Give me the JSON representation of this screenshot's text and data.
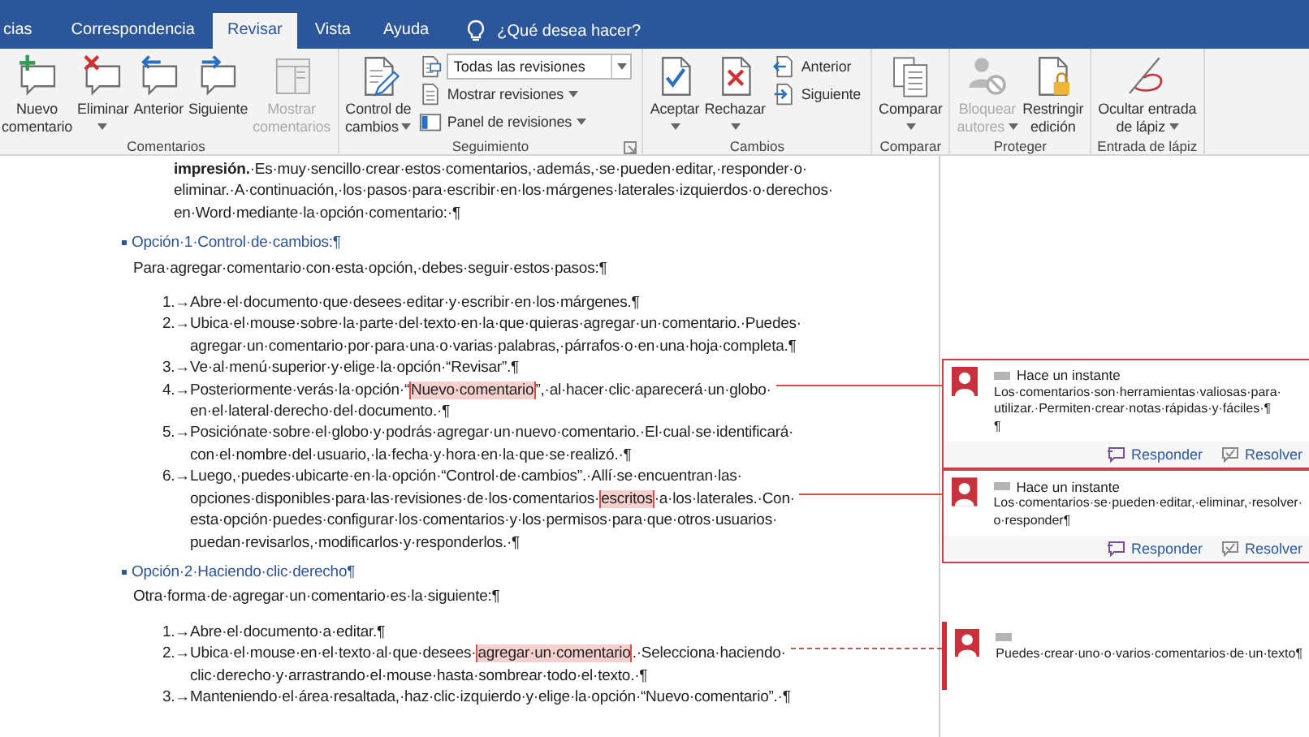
{
  "tabs": [
    {
      "label": "cias",
      "selected": false
    },
    {
      "label": "Correspondencia",
      "selected": false
    },
    {
      "label": "Revisar",
      "selected": true
    },
    {
      "label": "Vista",
      "selected": false
    },
    {
      "label": "Ayuda",
      "selected": false
    }
  ],
  "tell_me": "¿Qué desea hacer?",
  "ribbon_groups": [
    {
      "label": "Comentarios",
      "launcher": false,
      "controls": [
        {
          "kind": "large",
          "lines": [
            "Nuevo",
            "comentario"
          ],
          "dropdown": false,
          "disabled": false
        },
        {
          "kind": "large",
          "lines": [
            "Eliminar"
          ],
          "dropdown": true,
          "disabled": false
        },
        {
          "kind": "large",
          "lines": [
            "Anterior"
          ],
          "dropdown": false,
          "disabled": false
        },
        {
          "kind": "large",
          "lines": [
            "Siguiente"
          ],
          "dropdown": false,
          "disabled": false
        },
        {
          "kind": "large",
          "lines": [
            "Mostrar",
            "comentarios"
          ],
          "dropdown": false,
          "disabled": true
        }
      ]
    },
    {
      "label": "Seguimiento",
      "launcher": true,
      "controls": [
        {
          "kind": "large",
          "lines": [
            "Control de",
            "cambios"
          ],
          "dropdown": true,
          "disabled": false
        },
        {
          "kind": "stack",
          "items": [
            {
              "kind": "combo",
              "value": "Todas las revisiones"
            },
            {
              "kind": "small",
              "label": "Mostrar revisiones",
              "dropdown": true,
              "disabled": false
            },
            {
              "kind": "small",
              "label": "Panel de revisiones",
              "dropdown": true,
              "disabled": false
            }
          ]
        }
      ]
    },
    {
      "label": "Cambios",
      "launcher": false,
      "controls": [
        {
          "kind": "large",
          "lines": [
            "Aceptar"
          ],
          "dropdown": true,
          "disabled": false
        },
        {
          "kind": "large",
          "lines": [
            "Rechazar"
          ],
          "dropdown": true,
          "disabled": false
        },
        {
          "kind": "stack",
          "items": [
            {
              "kind": "small",
              "label": "Anterior",
              "dropdown": false,
              "disabled": false
            },
            {
              "kind": "small",
              "label": "Siguiente",
              "dropdown": false,
              "disabled": false
            }
          ]
        }
      ]
    },
    {
      "label": "Comparar",
      "launcher": false,
      "controls": [
        {
          "kind": "large",
          "lines": [
            "Comparar"
          ],
          "dropdown": true,
          "disabled": false
        }
      ]
    },
    {
      "label": "Proteger",
      "launcher": false,
      "controls": [
        {
          "kind": "large",
          "lines": [
            "Bloquear",
            "autores"
          ],
          "dropdown": true,
          "disabled": true
        },
        {
          "kind": "large",
          "lines": [
            "Restringir",
            "edición"
          ],
          "dropdown": false,
          "disabled": false
        }
      ]
    },
    {
      "label": "Entrada de lápiz",
      "launcher": false,
      "controls": [
        {
          "kind": "large",
          "lines": [
            "Ocultar entrada",
            "de lápiz"
          ],
          "dropdown": true,
          "disabled": false
        }
      ]
    }
  ],
  "document": {
    "blocks": [
      {
        "kind": "continuation",
        "lines": [
          "**impresión.**·Es·muy·sencillo·crear·estos·comentarios,·además,·se·pueden·editar,·responder·o·",
          "eliminar.·A·continuación,·los·pasos·para·escribir·en·los·márgenes·laterales·izquierdos·o·derechos·",
          "en·Word·mediante·la·opción·comentario:·¶"
        ]
      },
      {
        "kind": "heading",
        "lines": [
          "Opción·1·Control·de·cambios:¶"
        ]
      },
      {
        "kind": "paragraph",
        "lines": [
          "Para·agregar·comentario·con·esta·opción,·debes·seguir·estos·pasos:¶"
        ]
      },
      {
        "kind": "list",
        "items": [
          {
            "number": "1.→",
            "lines": [
              "Abre·el·documento·que·desees·editar·y·escribir·en·los·márgenes.¶"
            ]
          },
          {
            "number": "2.→",
            "lines": [
              "Ubica·el·mouse·sobre·la·parte·del·texto·en·la·que·quieras·agregar·un·comentario.·Puedes·",
              "agregar·un·comentario·por·para·una·o·varias·palabras,·párrafos·o·en·una·hoja·completa.¶"
            ]
          },
          {
            "number": "3.→",
            "lines": [
              "Ve·al·menú·superior·y·elige·la·opción·“Revisar”.¶"
            ]
          },
          {
            "number": "4.→",
            "lines": [
              [
                {
                  "text": "Posteriormente·verás·la·opción·“",
                  "highlighted": false
                },
                {
                  "text": "Nuevo·comentario",
                  "highlighted": true
                },
                {
                  "text": "”,·al·hacer·clic·aparecerá·un·globo·",
                  "highlighted": false
                }
              ],
              "en·el·lateral·derecho·del·documento.·¶"
            ]
          },
          {
            "number": "5.→",
            "lines": [
              "Posiciónate·sobre·el·globo·y·podrás·agregar·un·nuevo·comentario.·El·cual·se·identificará·",
              "con·el·nombre·del·usuario,·la·fecha·y·hora·en·la·que·se·realizó.·¶"
            ]
          },
          {
            "number": "6.→",
            "lines": [
              "Luego,·puedes·ubicarte·en·la·opción·“Control·de·cambios”.·Allí·se·encuentran·las·",
              [
                {
                  "text": "opciones·disponibles·para·las·revisiones·de·los·comentarios·",
                  "highlighted": false
                },
                {
                  "text": "escritos",
                  "highlighted": true
                },
                {
                  "text": "·a·los·laterales.·Con·",
                  "highlighted": false
                }
              ],
              "esta·opción·puedes·configurar·los·comentarios·y·los·permisos·para·que·otros·usuarios·",
              "puedan·revisarlos,·modificarlos·y·responderlos.·¶"
            ]
          }
        ]
      },
      {
        "kind": "heading",
        "lines": [
          "Opción·2·Haciendo·clic·derecho¶"
        ]
      },
      {
        "kind": "paragraph",
        "lines": [
          "Otra·forma·de·agregar·un·comentario·es·la·siguiente:¶"
        ]
      },
      {
        "kind": "list",
        "items": [
          {
            "number": "1.→",
            "lines": [
              "Abre·el·documento·a·editar.¶"
            ]
          },
          {
            "number": "2.→",
            "lines": [
              [
                {
                  "text": "Ubica·el·mouse·en·el·texto·al·que·desees·",
                  "highlighted": false
                },
                {
                  "text": "agregar·un·comentario",
                  "highlighted": true
                },
                {
                  "text": ".·Selecciona·haciendo·",
                  "highlighted": false
                }
              ],
              "clic·derecho·y·arrastrando·el·mouse·hasta·sombrear·todo·el·texto.·¶"
            ]
          },
          {
            "number": "3.→",
            "lines": [
              "Manteniendo·el·área·resaltada,·haz·clic·izquierdo·y·elige·la·opción·“Nuevo·comentario”.·¶"
            ]
          }
        ]
      }
    ]
  },
  "comments": [
    {
      "time": "Hace un instante",
      "lines": [
        "Los·comentarios·son·herramientas·valiosas·para·",
        "utilizar.·Permiten·crear·notas·rápidas·y·fáciles·¶",
        "¶"
      ],
      "actions": [
        "Responder",
        "Resolver"
      ],
      "editing": false
    },
    {
      "time": "Hace un instante",
      "lines": [
        "Los·comentarios·se·pueden·editar,·eliminar,·resolver·",
        "o·responder¶"
      ],
      "actions": [
        "Responder",
        "Resolver"
      ],
      "editing": false
    },
    {
      "lines": [
        "Puedes·crear·uno·o·varios·comentarios·de·un·texto¶"
      ],
      "editing": true
    }
  ]
}
